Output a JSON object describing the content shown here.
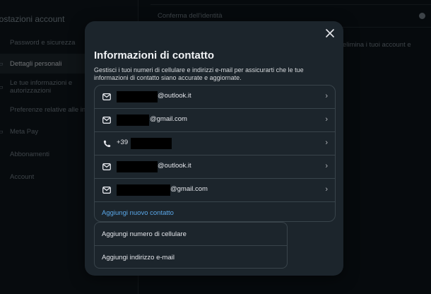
{
  "sidebar": {
    "title": "postazioni account",
    "items": [
      {
        "label": "Password e sicurezza",
        "icon": "shield-icon"
      },
      {
        "label": "Dettagli personali",
        "icon": "id-card-icon"
      },
      {
        "label_line1": "Le tue informazioni e",
        "label_line2": "autorizzazioni",
        "icon": "info-icon"
      },
      {
        "label": "Preferenze relative alle in",
        "icon": "settings-icon"
      },
      {
        "label": "Meta Pay",
        "icon": "card-icon"
      },
      {
        "label": "Abbonamenti",
        "icon": "subscription-icon"
      },
      {
        "label": "Account",
        "icon": "user-icon"
      }
    ]
  },
  "main": {
    "row1": "Conferma dell'identità",
    "row2": "elimina i tuoi account e"
  },
  "modal": {
    "title": "Informazioni di contatto",
    "description": "Gestisci i tuoi numeri di cellulare e indirizzi e-mail per assicurarti che le tue informazioni di contatto siano accurate e aggiornate.",
    "contacts": [
      {
        "type": "email",
        "icon": "mail-icon",
        "text": "@outlook.it"
      },
      {
        "type": "email",
        "icon": "mail-icon",
        "text": "@gmail.com"
      },
      {
        "type": "phone",
        "icon": "phone-icon",
        "text": "+39"
      },
      {
        "type": "email",
        "icon": "mail-icon",
        "text": "@outlook.it"
      },
      {
        "type": "email",
        "icon": "mail-icon",
        "text": "@gmail.com"
      }
    ],
    "add_contact_label": "Aggiungi nuovo contatto",
    "dropdown": {
      "add_phone_label": "Aggiungi numero di cellulare",
      "add_email_label": "Aggiungi indirizzo e-mail"
    }
  },
  "colors": {
    "accent_link": "#5aa7e8",
    "modal_bg": "#1c252c",
    "page_bg": "#0c1318"
  }
}
